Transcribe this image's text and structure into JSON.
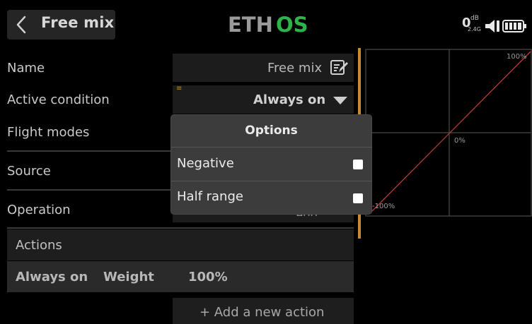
{
  "header": {
    "title": "Free mix",
    "logo_left": "ETH",
    "logo_right": "OS",
    "rssi_value": "0",
    "rssi_unit": "dB",
    "rssi_freq": "2.4G",
    "icons": [
      "back-icon",
      "speaker-icon",
      "battery-icon"
    ]
  },
  "form": {
    "name_label": "Name",
    "name_value": "Free mix",
    "active_label": "Active condition",
    "active_value": "Always on",
    "flight_modes_label": "Flight modes",
    "source_label": "Source",
    "operation_label": "Operation",
    "operation_value": "Add"
  },
  "graph": {
    "top_label": "100%",
    "center_label": "0%",
    "bottom_label": "-100%"
  },
  "actions": {
    "header": "Actions",
    "row_condition": "Always on",
    "row_type": "Weight",
    "row_value": "100%",
    "add_label": "+ Add a new action"
  },
  "dialog": {
    "title": "Options",
    "options": [
      {
        "label": "Negative",
        "checked": false
      },
      {
        "label": "Half range",
        "checked": false
      }
    ]
  },
  "colors": {
    "accent_green": "#2eb34a",
    "curve_red": "#c0392b",
    "orange_bar": "#c98a2e"
  }
}
